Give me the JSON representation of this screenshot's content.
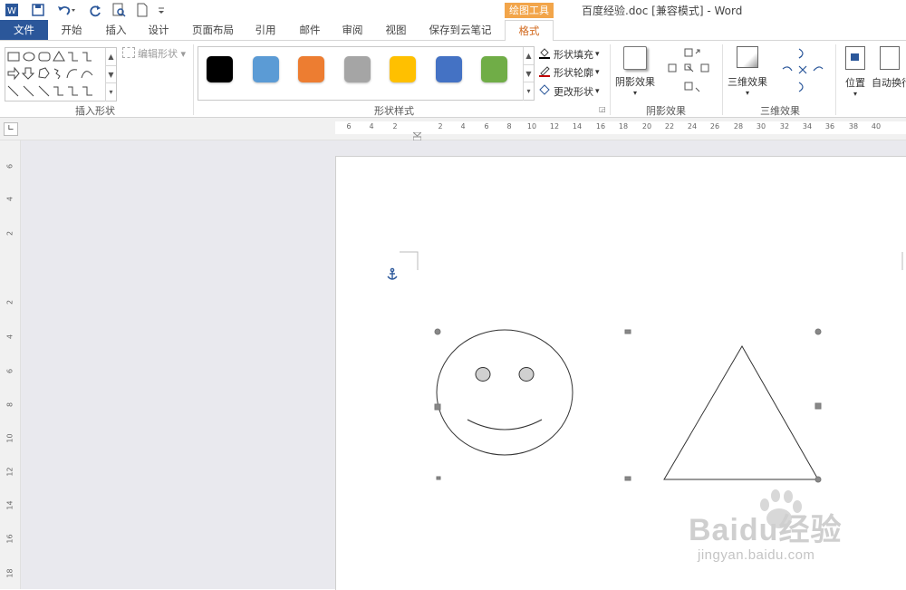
{
  "title": {
    "document": "百度经验.doc [兼容模式] - Word",
    "tools_tab": "绘图工具"
  },
  "quick_access": [
    "word-icon",
    "save-icon",
    "undo-icon",
    "redo-icon",
    "print-preview-icon",
    "new-document-icon",
    "customize-icon"
  ],
  "tabs": [
    {
      "label": "文件"
    },
    {
      "label": "开始"
    },
    {
      "label": "插入"
    },
    {
      "label": "设计"
    },
    {
      "label": "页面布局"
    },
    {
      "label": "引用"
    },
    {
      "label": "邮件"
    },
    {
      "label": "审阅"
    },
    {
      "label": "视图"
    },
    {
      "label": "保存到云笔记"
    },
    {
      "label": "格式"
    }
  ],
  "ribbon": {
    "insert_shapes": {
      "label": "插入形状",
      "edit_shape": "编辑形状 ▾"
    },
    "shape_styles": {
      "label": "形状样式",
      "swatches": [
        "#000000",
        "#5b9bd5",
        "#ed7d31",
        "#a5a5a5",
        "#ffc000",
        "#4472c4",
        "#70ad47"
      ],
      "fill": "形状填充",
      "outline": "形状轮廓",
      "change": "更改形状"
    },
    "shadow_effects": {
      "label": "阴影效果",
      "button": "阴影效果"
    },
    "effects_3d": {
      "label": "三维效果",
      "button": "三维效果"
    },
    "arrange": {
      "position": "位置",
      "wrap": "自动换行"
    }
  },
  "ruler": {
    "h_numbers": [
      "6",
      "4",
      "2",
      "2",
      "4",
      "6",
      "8",
      "10",
      "12",
      "14",
      "16",
      "18",
      "20",
      "22",
      "24",
      "26",
      "28",
      "30",
      "32",
      "34",
      "36",
      "38",
      "40"
    ],
    "v_numbers": [
      "6",
      "4",
      "2",
      "2",
      "4",
      "6",
      "8",
      "10",
      "12",
      "14",
      "16",
      "18"
    ]
  },
  "watermark": {
    "brand": "Baidu经验",
    "url": "jingyan.baidu.com"
  }
}
